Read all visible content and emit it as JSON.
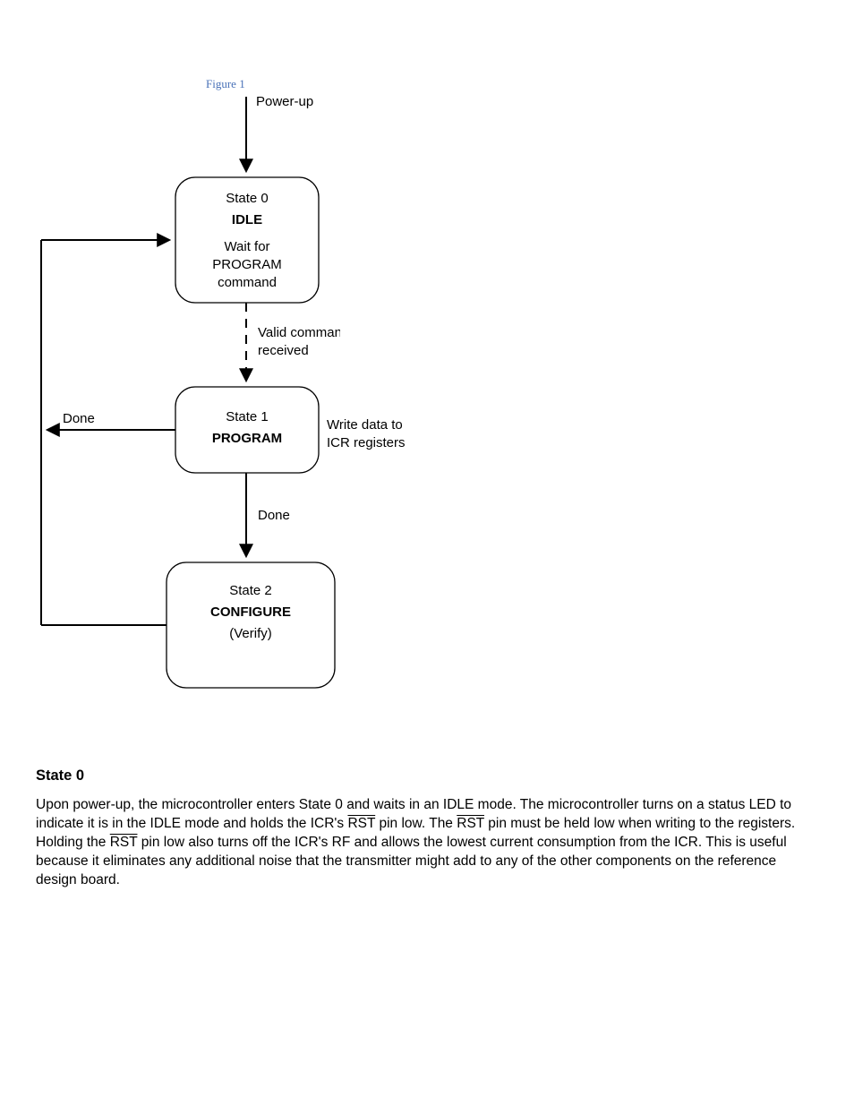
{
  "figure": {
    "caption": "Figure 1",
    "top_label": "Power-up",
    "box1": {
      "l1": "State 0",
      "l2": "IDLE",
      "l3": "Wait for",
      "l4": "PROGRAM",
      "l5": "command"
    },
    "arrow12_l1": "Valid command",
    "arrow12_l2": "received",
    "box2": {
      "l1": "State 1",
      "l2": "PROGRAM"
    },
    "side2_l1": "Write data to",
    "side2_l2": "ICR registers",
    "edge_left": "Done",
    "box3": {
      "l1": "State 2",
      "l2": "CONFIGURE",
      "l3": "(Verify)"
    }
  },
  "section": {
    "heading": "State 0",
    "p1a": "Upon power-up, the microcontroller enters State 0 and waits in an IDLE mode. The microcontroller turns on a status LED to indicate it is in the IDLE mode and holds the ICR's ",
    "p1_rst1": "RST",
    "p1b": " pin low. The ",
    "p1_rst2": "RST",
    "p1c": " pin must be held low when writing to the registers. Holding the ",
    "p1_rst3": "RST",
    "p1d": " pin low also turns off the ICR's RF and allows the lowest current consumption from the ICR. This is useful because it eliminates any additional noise that the transmitter might add to any of the other components on the reference design board."
  }
}
